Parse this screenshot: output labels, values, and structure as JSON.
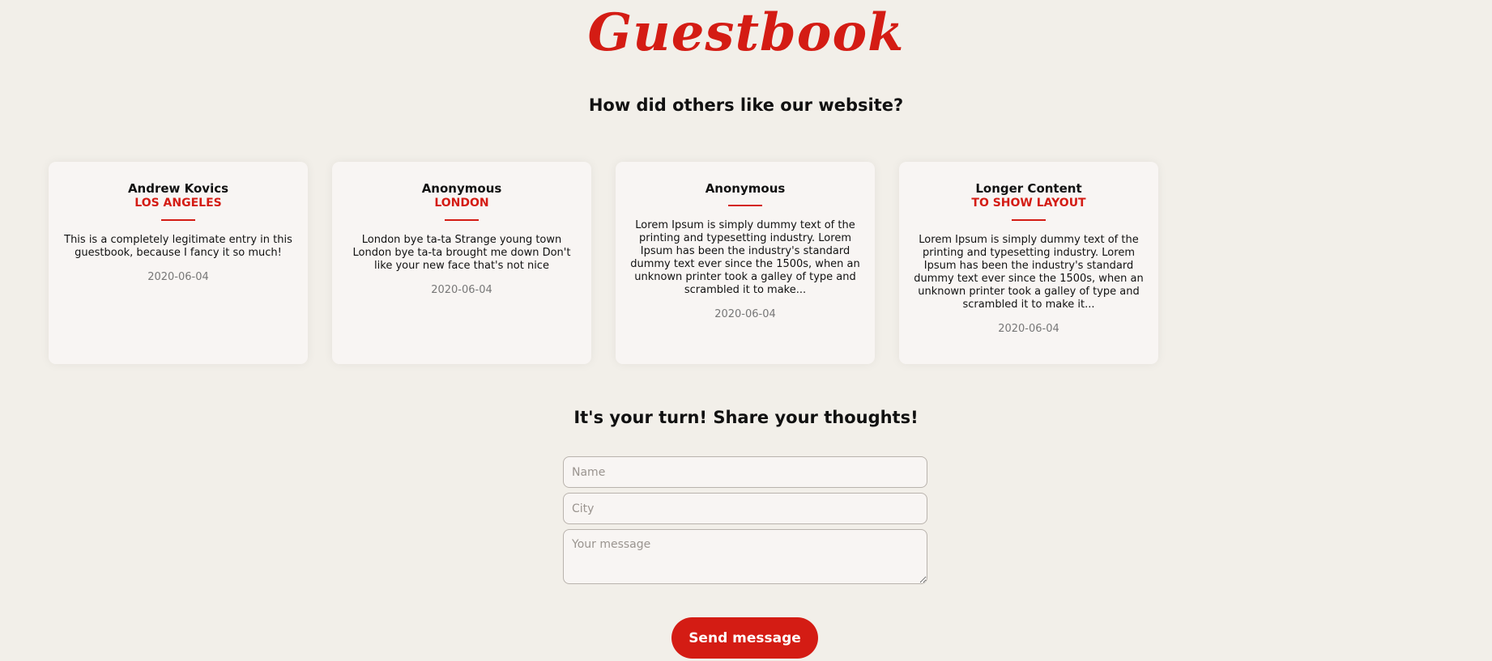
{
  "site": {
    "title": "Guestbook"
  },
  "reviews": {
    "heading": "How did others like our website?",
    "entries": [
      {
        "name": "Andrew Kovics",
        "city": "LOS ANGELES",
        "message": "This is a completely legitimate entry in this guestbook, because I fancy it so much!",
        "date": "2020-06-04"
      },
      {
        "name": "Anonymous",
        "city": "LONDON",
        "message": "London bye ta-ta Strange young town London bye ta-ta brought me down Don't like your new face that's not nice",
        "date": "2020-06-04"
      },
      {
        "name": "Anonymous",
        "city": "",
        "message": "Lorem Ipsum is simply dummy text of the printing and typesetting industry. Lorem Ipsum has been the industry's standard dummy text ever since the 1500s, when an unknown printer took a galley of type and scrambled it to make...",
        "date": "2020-06-04"
      },
      {
        "name": "Longer Content",
        "city": "TO SHOW LAYOUT",
        "message": "Lorem Ipsum is simply dummy text of the printing and typesetting industry. Lorem Ipsum has been the industry's standard dummy text ever since the 1500s, when an unknown printer took a galley of type and scrambled it to make it...",
        "date": "2020-06-04"
      }
    ]
  },
  "form": {
    "heading": "It's your turn! Share your thoughts!",
    "name_placeholder": "Name",
    "name_value": "",
    "city_placeholder": "City",
    "city_value": "",
    "message_placeholder": "Your message",
    "message_value": "",
    "submit_label": "Send message"
  },
  "colors": {
    "background": "#f2efe9",
    "accent": "#d41c14",
    "card_background": "#f8f5f3",
    "date_text": "#777777"
  }
}
